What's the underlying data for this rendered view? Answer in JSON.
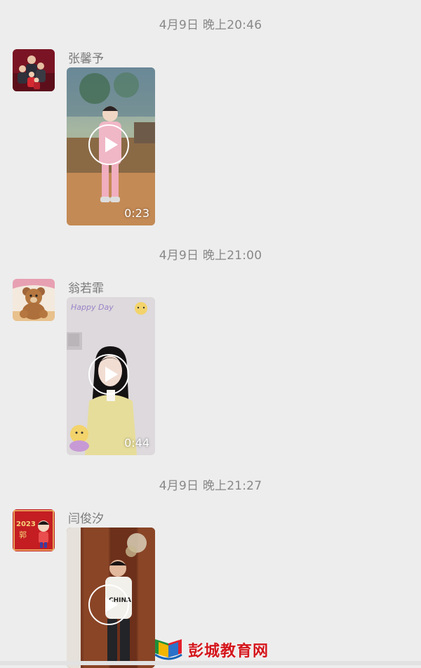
{
  "messages": [
    {
      "timestamp": "4月9日 晚上20:46",
      "sender": "张馨予",
      "duration": "0:23",
      "avatar_icon": "family-photo-icon"
    },
    {
      "timestamp": "4月9日 晚上21:00",
      "sender": "翁若霏",
      "duration": "0:44",
      "avatar_icon": "teddy-bear-icon"
    },
    {
      "timestamp": "4月9日 晚上21:27",
      "sender": "闫俊汐",
      "duration": "",
      "avatar_icon": "new-year-card-icon"
    }
  ],
  "stickers": {
    "happy_day": "Happy Day",
    "avatar3_year": "2023",
    "avatar3_char": "郭",
    "shirt_text": "CHINA"
  },
  "watermark": {
    "text": "彭城教育网",
    "icon": "book-logo-icon"
  },
  "colors": {
    "background": "#ededed",
    "timestamp": "#888888",
    "sender": "#7a7a7a",
    "watermark": "#d4161c"
  }
}
